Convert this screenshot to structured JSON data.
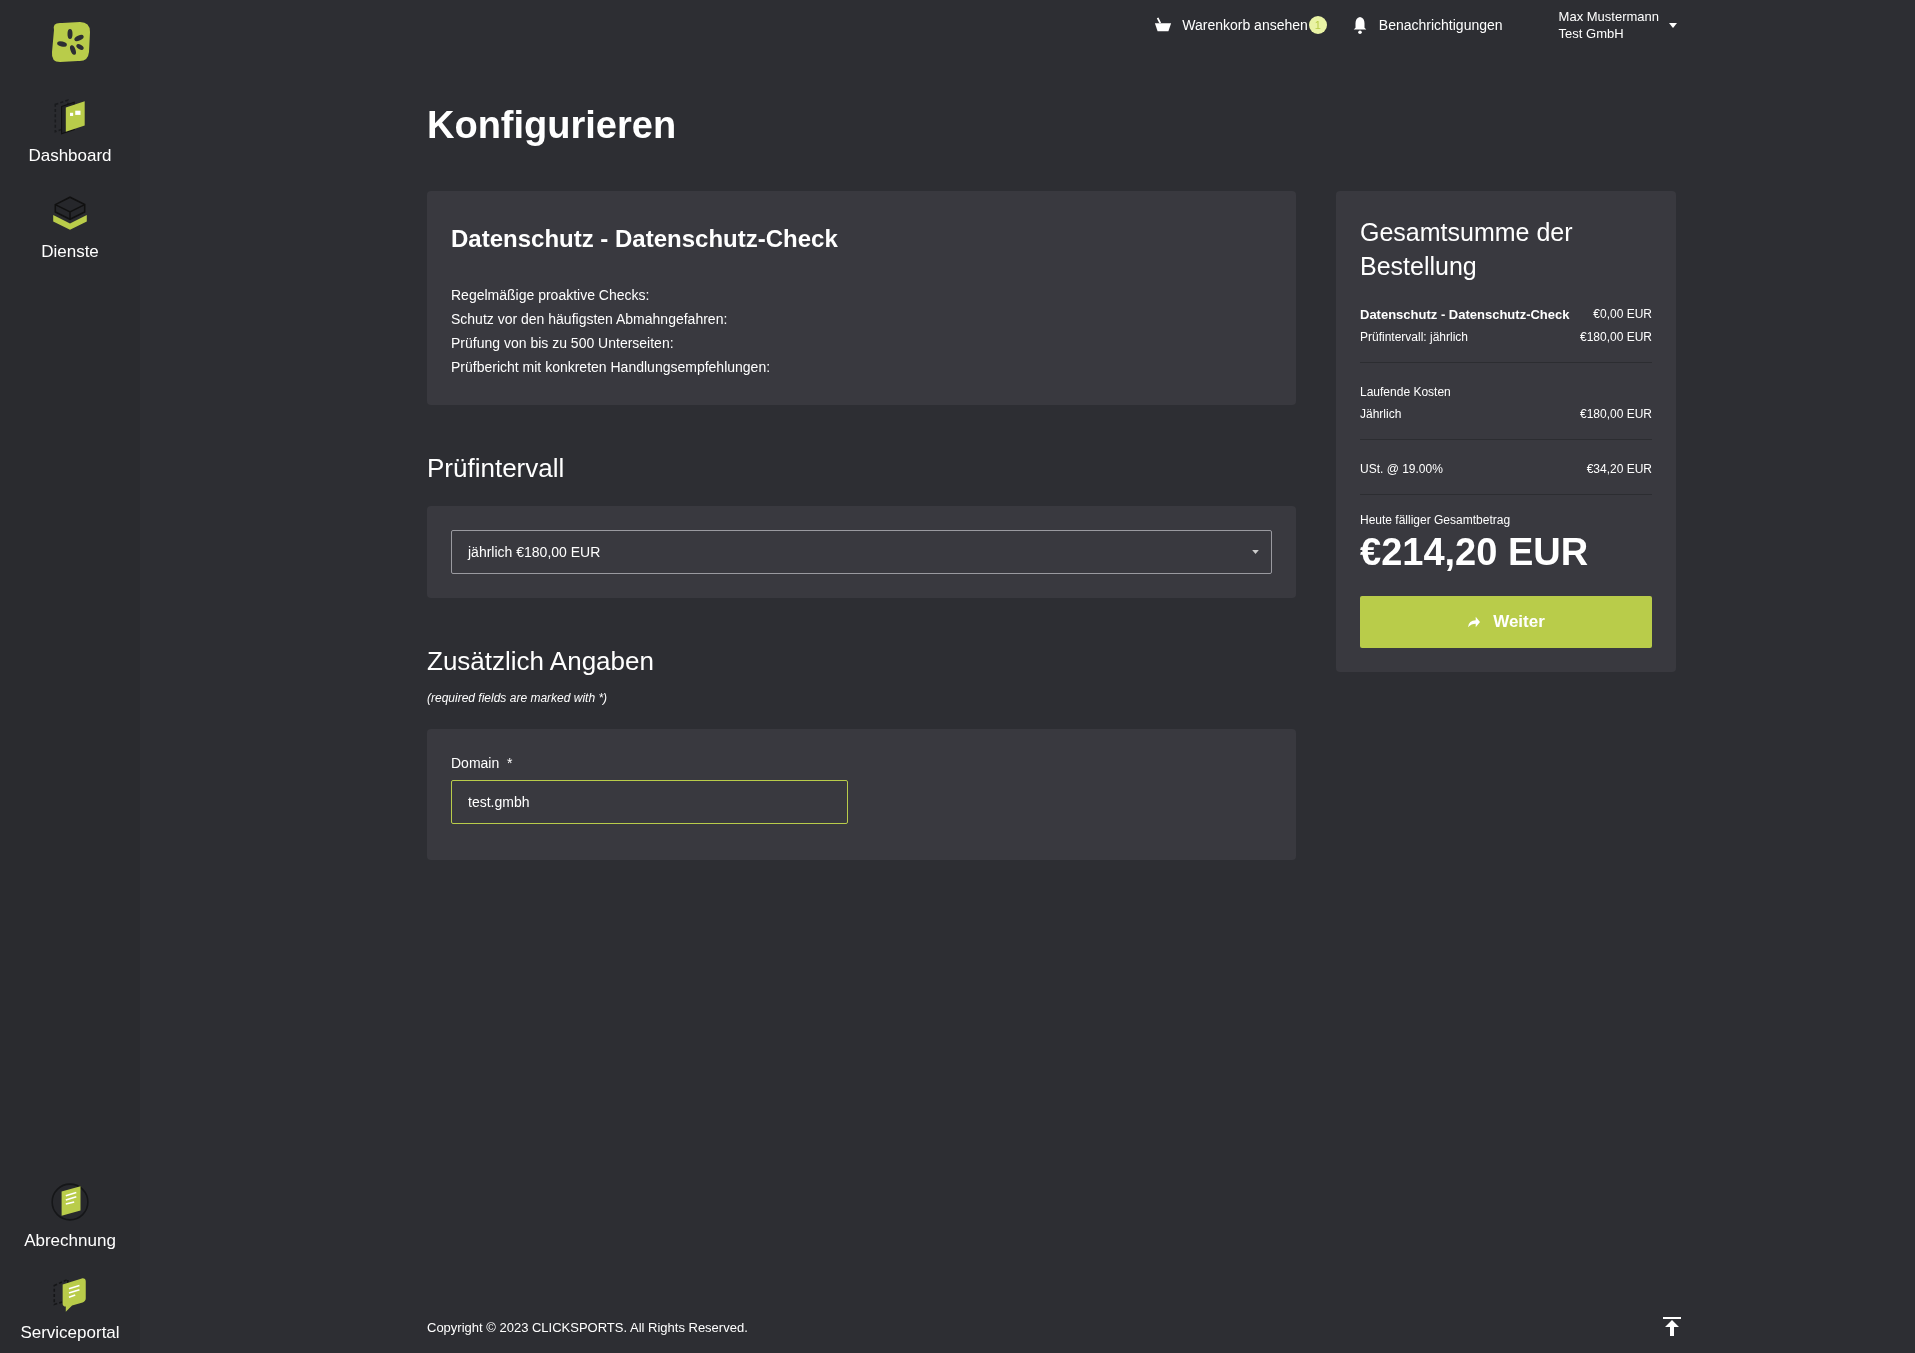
{
  "top_bar": {
    "cart": {
      "label": "Warenkorb ansehen",
      "count": "1"
    },
    "notifications": {
      "label": "Benachrichtigungen"
    },
    "user": {
      "name": "Max Mustermann",
      "company": "Test GmbH"
    }
  },
  "sidebar": {
    "top_items": [
      {
        "label": "Dashboard"
      },
      {
        "label": "Dienste"
      }
    ],
    "bottom_items": [
      {
        "label": "Abrechnung"
      },
      {
        "label": "Serviceportal"
      }
    ]
  },
  "page_title": "Konfigurieren",
  "product": {
    "title": "Datenschutz - Datenschutz-Check",
    "features": [
      "Regelmäßige proaktive Checks:",
      "Schutz vor den häufigsten Abmahngefahren:",
      "Prüfung von bis zu 500 Unterseiten:",
      "Prüfbericht mit konkreten Handlungsempfehlungen:"
    ]
  },
  "interval": {
    "heading": "Prüfintervall",
    "select": {
      "value": "jährlich €180,00 EUR"
    }
  },
  "additional": {
    "heading": "Zusätzlich Angaben",
    "note": "(required fields are marked with *)",
    "fields": [
      {
        "label": "Domain",
        "required_mark": "*",
        "value": "test.gmbh",
        "focused": true
      }
    ]
  },
  "summary": {
    "title": "Gesamtsumme der Bestellung",
    "sections": [
      {
        "rows": [
          {
            "label": "Datenschutz - Datenschutz-Check",
            "amount": "€0,00 EUR",
            "emphasis": true
          },
          {
            "label": "Prüfintervall: jährlich",
            "amount": "€180,00 EUR",
            "emphasis": false
          }
        ]
      },
      {
        "heading": "Laufende Kosten",
        "rows": [
          {
            "label": "Jährlich",
            "amount": "€180,00 EUR",
            "emphasis": false
          }
        ]
      },
      {
        "rows": [
          {
            "label": "USt. @ 19.00%",
            "amount": "€34,20 EUR",
            "emphasis": false
          }
        ]
      }
    ],
    "total_label": "Heute fälliger Gesamtbetrag",
    "total": "€214,20 EUR",
    "button": "Weiter"
  },
  "footer": {
    "copyright": "Copyright © 2023 CLICKSPORTS. All Rights Reserved."
  }
}
